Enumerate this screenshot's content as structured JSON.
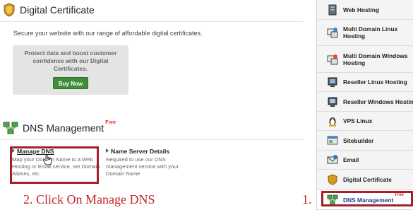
{
  "main": {
    "cert_section": {
      "title": "Digital Certificate",
      "description": "Secure your website with our range of affordable digital certificates.",
      "promo_text": "Protect data and boost customer confidence with our Digital Certificates.",
      "buy_label": "Buy Now"
    },
    "dns_section": {
      "title": "DNS Management",
      "free_badge": "Free",
      "manage_dns": {
        "title": "Manage DNS",
        "description": "Map your Domain Name to a Web Hosting or Email service, set Domain Aliases, etc"
      },
      "name_server": {
        "title": "Name Server Details",
        "description": "Required to use our DNS management service with your Domain Name"
      }
    }
  },
  "instructions": {
    "step2": "2. Click On Manage DNS",
    "step1": "1."
  },
  "sidebar": {
    "items": [
      {
        "label": "Web Hosting",
        "icon": "server-icon"
      },
      {
        "label": "Multi Domain Linux Hosting",
        "icon": "multi-server-icon"
      },
      {
        "label": "Multi Domain Windows Hosting",
        "icon": "multi-server-icon"
      },
      {
        "label": "Reseller Linux Hosting",
        "icon": "reseller-icon"
      },
      {
        "label": "Reseller Windows Hosting",
        "icon": "reseller-icon"
      },
      {
        "label": "VPS Linux",
        "icon": "linux-penguin-icon"
      },
      {
        "label": "Sitebuilder",
        "icon": "sitebuilder-icon"
      },
      {
        "label": "Email",
        "icon": "email-icon"
      },
      {
        "label": "Digital Certificate",
        "icon": "certificate-icon"
      },
      {
        "label": "DNS Management",
        "icon": "dns-icon",
        "badge": "Free"
      }
    ]
  },
  "colors": {
    "highlight_border": "#a4202a",
    "instruction_text": "#c0272d",
    "free_badge": "#e1251b",
    "buy_button": "#3f8e3a"
  }
}
